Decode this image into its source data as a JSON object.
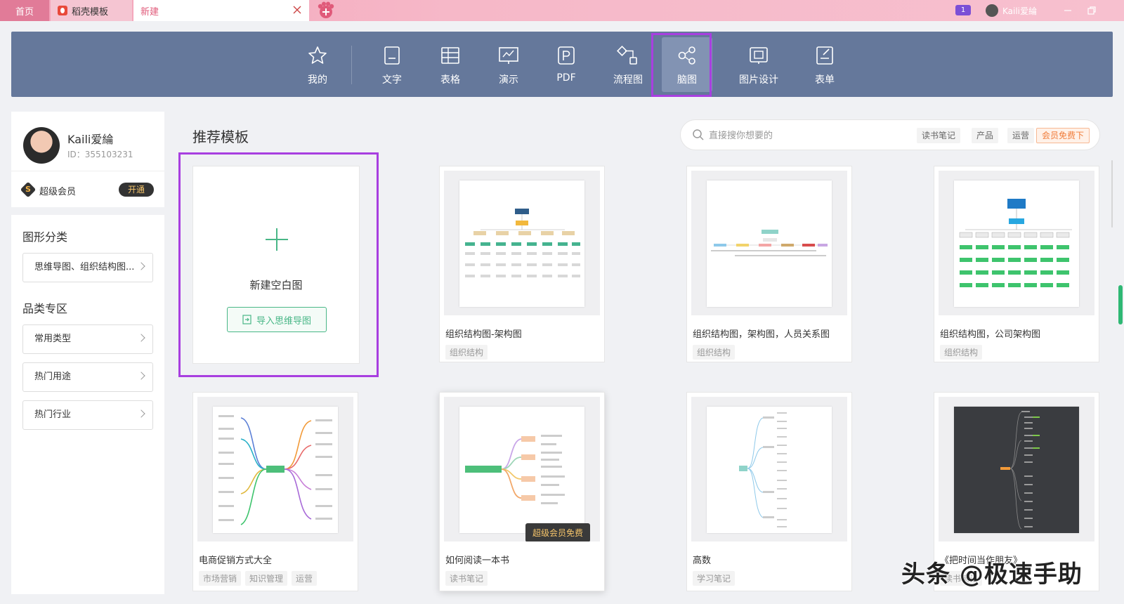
{
  "tabs": {
    "home": "首页",
    "daoke": "稻壳模板",
    "new": "新建"
  },
  "titlebar": {
    "badge": "1",
    "user": "Kaili爱綸"
  },
  "toolbar": {
    "items": [
      {
        "label": "我的",
        "icon": "star-icon"
      },
      {
        "label": "文字",
        "icon": "document-icon"
      },
      {
        "label": "表格",
        "icon": "table-icon"
      },
      {
        "label": "演示",
        "icon": "presentation-icon"
      },
      {
        "label": "PDF",
        "icon": "pdf-icon"
      },
      {
        "label": "流程图",
        "icon": "flowchart-icon"
      },
      {
        "label": "脑图",
        "icon": "mindmap-icon",
        "active": true
      },
      {
        "label": "图片设计",
        "icon": "image-design-icon"
      },
      {
        "label": "表单",
        "icon": "form-icon"
      }
    ]
  },
  "user": {
    "name": "Kaili爱綸",
    "id": "ID：355103231",
    "vip_label": "超级会员",
    "open_label": "开通"
  },
  "sidebar": {
    "shape_heading": "图形分类",
    "shape_item": "思维导图、组织结构图...",
    "category_heading": "品类专区",
    "category_items": [
      "常用类型",
      "热门用途",
      "热门行业"
    ]
  },
  "main": {
    "title": "推荐模板",
    "search_placeholder": "直接搜你想要的",
    "chips": [
      "读书笔记",
      "产品",
      "运营",
      "会员免费下"
    ],
    "new_blank": "新建空白图",
    "import_label": "导入思维导图"
  },
  "cards": [
    {
      "title": "组织结构图-架构图",
      "tags": [
        "组织结构"
      ]
    },
    {
      "title": "组织结构图，架构图，人员关系图",
      "tags": [
        "组织结构"
      ]
    },
    {
      "title": "组织结构图，公司架构图",
      "tags": [
        "组织结构"
      ]
    },
    {
      "title": "电商促销方式大全",
      "tags": [
        "市场营销",
        "知识管理",
        "运营"
      ]
    },
    {
      "title": "如何阅读一本书",
      "tags": [
        "读书笔记"
      ],
      "badge": "超级会员免费"
    },
    {
      "title": "高数",
      "tags": [
        "学习笔记"
      ]
    },
    {
      "title": "《把时间当作朋友》",
      "tags": [
        "读书笔记"
      ]
    }
  ],
  "watermark": "头条 @极速手助",
  "colors": {
    "toolbar": "#65789b",
    "highlight": "#a83fe0",
    "accent_green": "#49b787",
    "tab_pink": "#f3a2b8"
  }
}
